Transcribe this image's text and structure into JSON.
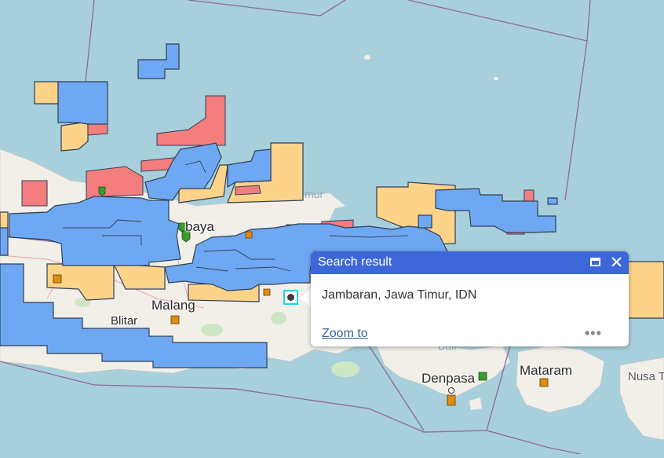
{
  "map": {
    "labels": {
      "surabaya": "baya",
      "malang": "Malang",
      "blitar": "Blitar",
      "timur": "mur",
      "bali_sea": "Bali",
      "denpasar": "Denpasa",
      "mataram": "Mataram",
      "nusa": "Nusa T"
    },
    "colors": {
      "sea": "#a8d0dc",
      "land": "#f2efe9",
      "blue_block": "#6fa8f2",
      "yellow_block": "#fdd38a",
      "red_block": "#f47e7e",
      "boundary": "#8e6f9e",
      "marker_outline": "#1fd6e6"
    }
  },
  "popup": {
    "title": "Search result",
    "address": "Jambaran, Jawa Timur, IDN",
    "zoom_to": "Zoom to",
    "more": "•••"
  }
}
